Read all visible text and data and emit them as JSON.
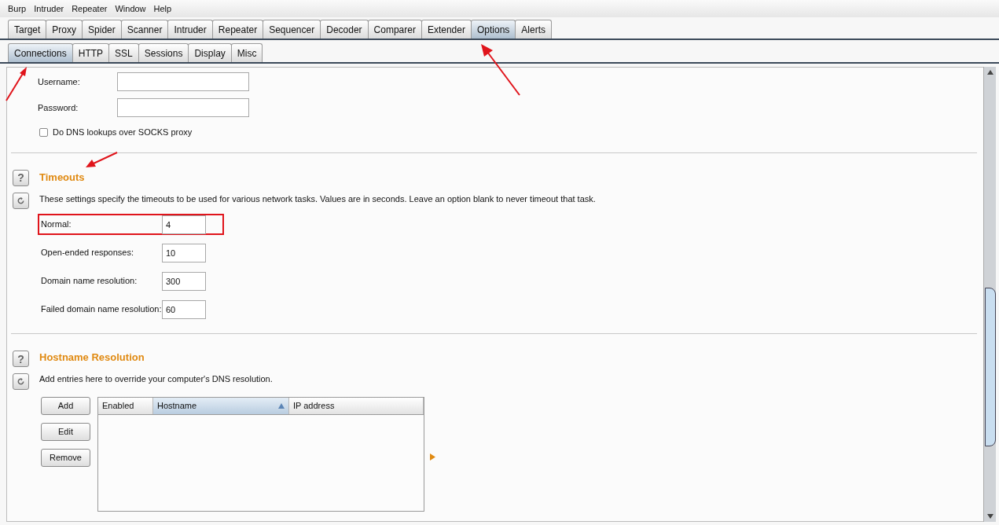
{
  "menu": [
    "Burp",
    "Intruder",
    "Repeater",
    "Window",
    "Help"
  ],
  "tabs": [
    {
      "label": "Target",
      "selected": false
    },
    {
      "label": "Proxy",
      "selected": false
    },
    {
      "label": "Spider",
      "selected": false
    },
    {
      "label": "Scanner",
      "selected": false
    },
    {
      "label": "Intruder",
      "selected": false
    },
    {
      "label": "Repeater",
      "selected": false
    },
    {
      "label": "Sequencer",
      "selected": false
    },
    {
      "label": "Decoder",
      "selected": false
    },
    {
      "label": "Comparer",
      "selected": false
    },
    {
      "label": "Extender",
      "selected": false
    },
    {
      "label": "Options",
      "selected": true
    },
    {
      "label": "Alerts",
      "selected": false
    }
  ],
  "subtabs": [
    {
      "label": "Connections",
      "selected": true
    },
    {
      "label": "HTTP",
      "selected": false
    },
    {
      "label": "SSL",
      "selected": false
    },
    {
      "label": "Sessions",
      "selected": false
    },
    {
      "label": "Display",
      "selected": false
    },
    {
      "label": "Misc",
      "selected": false
    }
  ],
  "proxy_auth": {
    "fields": [
      {
        "label": "Username:"
      },
      {
        "label": "Password:"
      }
    ],
    "checkbox": {
      "label": "Do DNS lookups over SOCKS proxy",
      "checked": false
    }
  },
  "timeouts": {
    "help_button": "?",
    "title": "Timeouts",
    "description": "These settings specify the timeouts to be used for various network tasks. Values are in seconds. Leave an option blank to never timeout that task.",
    "rows": [
      {
        "label": "Normal:",
        "value": "4",
        "highlighted": true
      },
      {
        "label": "Open-ended responses:",
        "value": "10",
        "highlighted": false
      },
      {
        "label": "Domain name resolution:",
        "value": "300",
        "highlighted": false
      },
      {
        "label": "Failed domain name resolution:",
        "value": "60",
        "highlighted": false
      }
    ]
  },
  "hostname_resolution": {
    "help_button": "?",
    "title": "Hostname Resolution",
    "description": "Add entries here to override your computer's DNS resolution.",
    "buttons": [
      "Add",
      "Edit",
      "Remove"
    ],
    "table": {
      "columns": [
        {
          "label": "Enabled",
          "sorted": false
        },
        {
          "label": "Hostname",
          "sorted": true
        },
        {
          "label": "IP address",
          "sorted": false
        }
      ]
    }
  }
}
